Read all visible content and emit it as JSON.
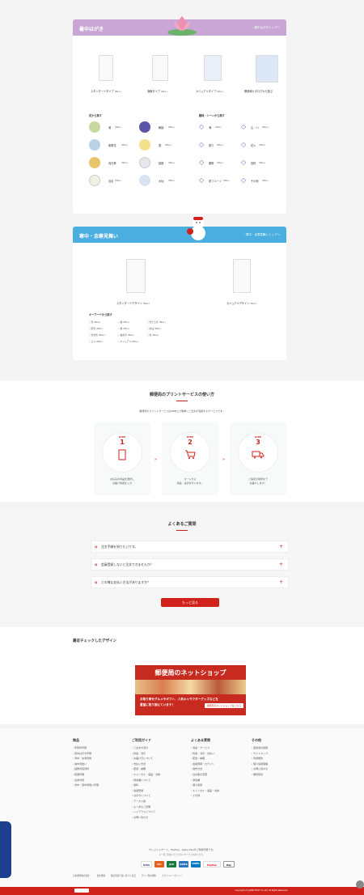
{
  "shochu": {
    "title": "暑中はがき",
    "more": "暑中はがきトップへ",
    "header_color": "#c9a6d6",
    "types": [
      {
        "label": "スタンダードタイプ",
        "sub": "(80+)"
      },
      {
        "label": "漁猟タイプ",
        "sub": "(82+)"
      },
      {
        "label": "カジュアルタイプ",
        "sub": "(80+)"
      },
      {
        "label": "郵便局カタログから選ぶ",
        "sub": ""
      }
    ],
    "flower_head": "花から探す",
    "scene_head": "趣味・シーンから探す",
    "flowers": [
      {
        "label": "菊",
        "sub": "(80+)"
      },
      {
        "label": "朝顔",
        "sub": "(80+)"
      },
      {
        "label": "紫陽花",
        "sub": "(80+)"
      },
      {
        "label": "蓮",
        "sub": "(80+)"
      },
      {
        "label": "向日葵",
        "sub": "(80+)"
      },
      {
        "label": "桔梗",
        "sub": "(80+)"
      },
      {
        "label": "百合",
        "sub": "(80+)"
      },
      {
        "label": "水仙",
        "sub": "(80+)"
      }
    ],
    "scenes": [
      {
        "label": "海",
        "sub": "(80+)"
      },
      {
        "label": "山・川",
        "sub": "(80+)"
      },
      {
        "label": "祭り",
        "sub": "(80+)"
      },
      {
        "label": "花火",
        "sub": "(80+)"
      },
      {
        "label": "果物",
        "sub": "(80+)"
      },
      {
        "label": "風鈴",
        "sub": "(80+)"
      },
      {
        "label": "夏フルーツ",
        "sub": "(80+)"
      },
      {
        "label": "その他",
        "sub": "(80+)"
      }
    ]
  },
  "kanchu": {
    "title": "寒中・余寒見舞い",
    "more": "寒中・余寒見舞いトップへ",
    "header_color": "#4aaee0",
    "types": [
      {
        "label": "スタンダードデザイン",
        "sub": "(80+)"
      },
      {
        "label": "カジュアルデザイン",
        "sub": "(80+)"
      }
    ],
    "keyword_head": "キーワードから探す",
    "keywords": [
      "雪 (80+)",
      "椿 (80+)",
      "雪だるま (80+)",
      "南天 (80+)",
      "梅 (80+)",
      "水仙 (80+)",
      "雪景色 (80+)",
      "福寿草 (80+)",
      "松 (80+)",
      "コメ (80+)",
      "カジュアル (80+)"
    ]
  },
  "howto": {
    "title": "郵便局のプリントサービスの使い方",
    "lead": "郵便局のプリントサービスはWEB上で簡単にご注文が完結するサービスです。",
    "steps": [
      {
        "label": "STEP",
        "num": "1",
        "desc": "お好みの商品を選択し\nお届け情報を入力"
      },
      {
        "label": "STEP",
        "num": "2",
        "desc": "カートから\n商品・決済を行います。"
      },
      {
        "label": "STEP",
        "num": "3",
        "desc": "ご指定の場所まで\nお届けします！"
      }
    ]
  },
  "faq": {
    "title": "よくあるご質問",
    "items": [
      "注文手順を知りたいです。",
      "会員登録しないと注文できませんか？",
      "どの様な支払い方法がありますか？"
    ],
    "more_button": "もっと見る"
  },
  "recent": {
    "title": "最近チェックしたデザイン"
  },
  "banner": {
    "title": "郵便局のネットショップ",
    "line": "お取り寄せグルメやギフト、人気キャラクターグッズなどを",
    "line2": "豊富に取り揃えています！",
    "cta": "郵便局のネットショップはこちら"
  },
  "footer": {
    "cols": [
      {
        "head": "商品",
        "items": [
          "年賀状印刷",
          "喪中はがき印刷",
          "寒中・余寒見舞",
          "暑中見舞い",
          "結婚式招待状",
          "転居印刷",
          "出産内祝",
          "寒中・喪中見舞い印刷"
        ]
      },
      {
        "head": "ご利用ガイド",
        "items": [
          "ご注文の流れ",
          "料金・割引",
          "お届け日について",
          "支払い方法",
          "配送・納期",
          "キャンセル・返品・交換",
          "領収書について",
          "送料",
          "会員登録",
          "はがきについて",
          "データ入稿",
          "よくあるご質問",
          "レイアウトについて",
          "お問い合わせ"
        ]
      },
      {
        "head": "よくある質問",
        "items": [
          "商品・サービス",
          "料金・割引・支払い",
          "配送・納期",
          "会員登録・ログイン",
          "操作方法",
          "注文後の変更",
          "領収書",
          "個人情報",
          "キャンセル・返品・交換",
          "その他"
        ]
      },
      {
        "head": "その他",
        "items": [
          "運営会社情報",
          "サイトマップ",
          "利用規約",
          "個人情報保護",
          "お問い合わせ",
          "推奨環境"
        ]
      }
    ],
    "pay_note": "クレジットカード、PayPay、Apple Payがご利用可能です。",
    "pay_note2": "※一部ご利用いただけないサービスがあります。",
    "pay_logos": [
      "VISA",
      "MC",
      "JCB",
      "AMEX",
      "DINERS",
      "PayPay",
      "Pay"
    ],
    "links": [
      "会社概要",
      "特定商取引法に基づく表記",
      "サイト利用規約",
      "プライバシーポリシー"
    ],
    "company": "日本郵便株式会社",
    "copyright": "Copyright (C) JAPAN POST Co.,Ltd. All Rights Reserved."
  }
}
